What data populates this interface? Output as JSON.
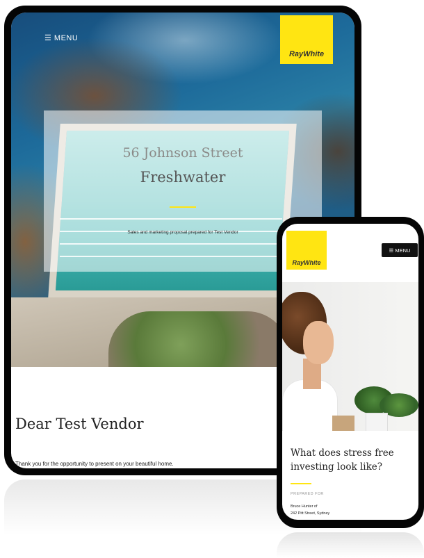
{
  "brand": {
    "logo_text": "RayWhite",
    "accent_color": "#ffe512"
  },
  "tablet": {
    "menu_label": "☰ MENU",
    "street": "56 Johnson Street",
    "suburb": "Freshwater",
    "prepared_text": "Sales and marketing proposal prepared for Test Vendor",
    "greeting": "Dear Test Vendor",
    "thanks": "Thank you for the opportunity to present on your beautiful home."
  },
  "phone": {
    "menu_label": "☰ MENU",
    "heading": "What does stress free investing look like?",
    "prepared_for_label": "PREPARED FOR",
    "recipient": "Bruce Hunter of",
    "address": "242 Pitt Street, Sydney"
  }
}
